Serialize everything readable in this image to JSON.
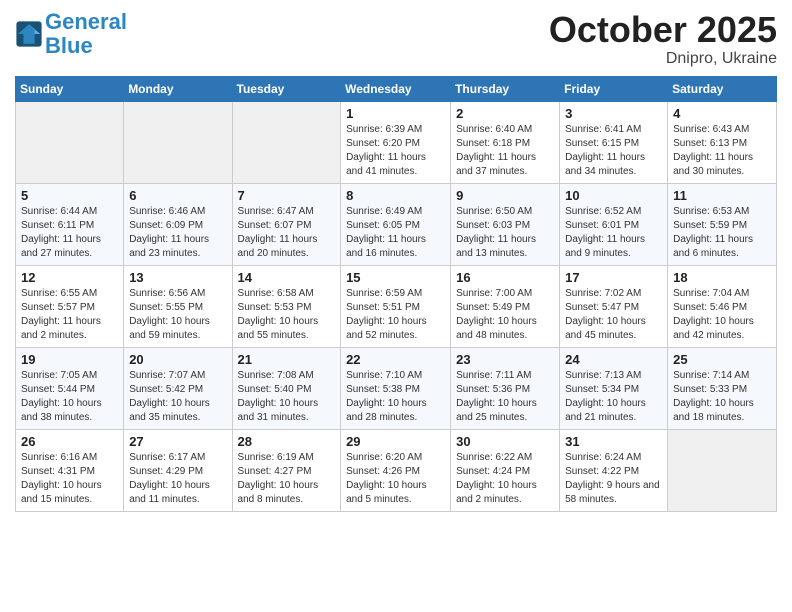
{
  "header": {
    "logo_line1": "General",
    "logo_line2": "Blue",
    "month": "October 2025",
    "location": "Dnipro, Ukraine"
  },
  "weekdays": [
    "Sunday",
    "Monday",
    "Tuesday",
    "Wednesday",
    "Thursday",
    "Friday",
    "Saturday"
  ],
  "weeks": [
    [
      {
        "day": "",
        "info": ""
      },
      {
        "day": "",
        "info": ""
      },
      {
        "day": "",
        "info": ""
      },
      {
        "day": "1",
        "info": "Sunrise: 6:39 AM\nSunset: 6:20 PM\nDaylight: 11 hours and 41 minutes."
      },
      {
        "day": "2",
        "info": "Sunrise: 6:40 AM\nSunset: 6:18 PM\nDaylight: 11 hours and 37 minutes."
      },
      {
        "day": "3",
        "info": "Sunrise: 6:41 AM\nSunset: 6:15 PM\nDaylight: 11 hours and 34 minutes."
      },
      {
        "day": "4",
        "info": "Sunrise: 6:43 AM\nSunset: 6:13 PM\nDaylight: 11 hours and 30 minutes."
      }
    ],
    [
      {
        "day": "5",
        "info": "Sunrise: 6:44 AM\nSunset: 6:11 PM\nDaylight: 11 hours and 27 minutes."
      },
      {
        "day": "6",
        "info": "Sunrise: 6:46 AM\nSunset: 6:09 PM\nDaylight: 11 hours and 23 minutes."
      },
      {
        "day": "7",
        "info": "Sunrise: 6:47 AM\nSunset: 6:07 PM\nDaylight: 11 hours and 20 minutes."
      },
      {
        "day": "8",
        "info": "Sunrise: 6:49 AM\nSunset: 6:05 PM\nDaylight: 11 hours and 16 minutes."
      },
      {
        "day": "9",
        "info": "Sunrise: 6:50 AM\nSunset: 6:03 PM\nDaylight: 11 hours and 13 minutes."
      },
      {
        "day": "10",
        "info": "Sunrise: 6:52 AM\nSunset: 6:01 PM\nDaylight: 11 hours and 9 minutes."
      },
      {
        "day": "11",
        "info": "Sunrise: 6:53 AM\nSunset: 5:59 PM\nDaylight: 11 hours and 6 minutes."
      }
    ],
    [
      {
        "day": "12",
        "info": "Sunrise: 6:55 AM\nSunset: 5:57 PM\nDaylight: 11 hours and 2 minutes."
      },
      {
        "day": "13",
        "info": "Sunrise: 6:56 AM\nSunset: 5:55 PM\nDaylight: 10 hours and 59 minutes."
      },
      {
        "day": "14",
        "info": "Sunrise: 6:58 AM\nSunset: 5:53 PM\nDaylight: 10 hours and 55 minutes."
      },
      {
        "day": "15",
        "info": "Sunrise: 6:59 AM\nSunset: 5:51 PM\nDaylight: 10 hours and 52 minutes."
      },
      {
        "day": "16",
        "info": "Sunrise: 7:00 AM\nSunset: 5:49 PM\nDaylight: 10 hours and 48 minutes."
      },
      {
        "day": "17",
        "info": "Sunrise: 7:02 AM\nSunset: 5:47 PM\nDaylight: 10 hours and 45 minutes."
      },
      {
        "day": "18",
        "info": "Sunrise: 7:04 AM\nSunset: 5:46 PM\nDaylight: 10 hours and 42 minutes."
      }
    ],
    [
      {
        "day": "19",
        "info": "Sunrise: 7:05 AM\nSunset: 5:44 PM\nDaylight: 10 hours and 38 minutes."
      },
      {
        "day": "20",
        "info": "Sunrise: 7:07 AM\nSunset: 5:42 PM\nDaylight: 10 hours and 35 minutes."
      },
      {
        "day": "21",
        "info": "Sunrise: 7:08 AM\nSunset: 5:40 PM\nDaylight: 10 hours and 31 minutes."
      },
      {
        "day": "22",
        "info": "Sunrise: 7:10 AM\nSunset: 5:38 PM\nDaylight: 10 hours and 28 minutes."
      },
      {
        "day": "23",
        "info": "Sunrise: 7:11 AM\nSunset: 5:36 PM\nDaylight: 10 hours and 25 minutes."
      },
      {
        "day": "24",
        "info": "Sunrise: 7:13 AM\nSunset: 5:34 PM\nDaylight: 10 hours and 21 minutes."
      },
      {
        "day": "25",
        "info": "Sunrise: 7:14 AM\nSunset: 5:33 PM\nDaylight: 10 hours and 18 minutes."
      }
    ],
    [
      {
        "day": "26",
        "info": "Sunrise: 6:16 AM\nSunset: 4:31 PM\nDaylight: 10 hours and 15 minutes."
      },
      {
        "day": "27",
        "info": "Sunrise: 6:17 AM\nSunset: 4:29 PM\nDaylight: 10 hours and 11 minutes."
      },
      {
        "day": "28",
        "info": "Sunrise: 6:19 AM\nSunset: 4:27 PM\nDaylight: 10 hours and 8 minutes."
      },
      {
        "day": "29",
        "info": "Sunrise: 6:20 AM\nSunset: 4:26 PM\nDaylight: 10 hours and 5 minutes."
      },
      {
        "day": "30",
        "info": "Sunrise: 6:22 AM\nSunset: 4:24 PM\nDaylight: 10 hours and 2 minutes."
      },
      {
        "day": "31",
        "info": "Sunrise: 6:24 AM\nSunset: 4:22 PM\nDaylight: 9 hours and 58 minutes."
      },
      {
        "day": "",
        "info": ""
      }
    ]
  ]
}
